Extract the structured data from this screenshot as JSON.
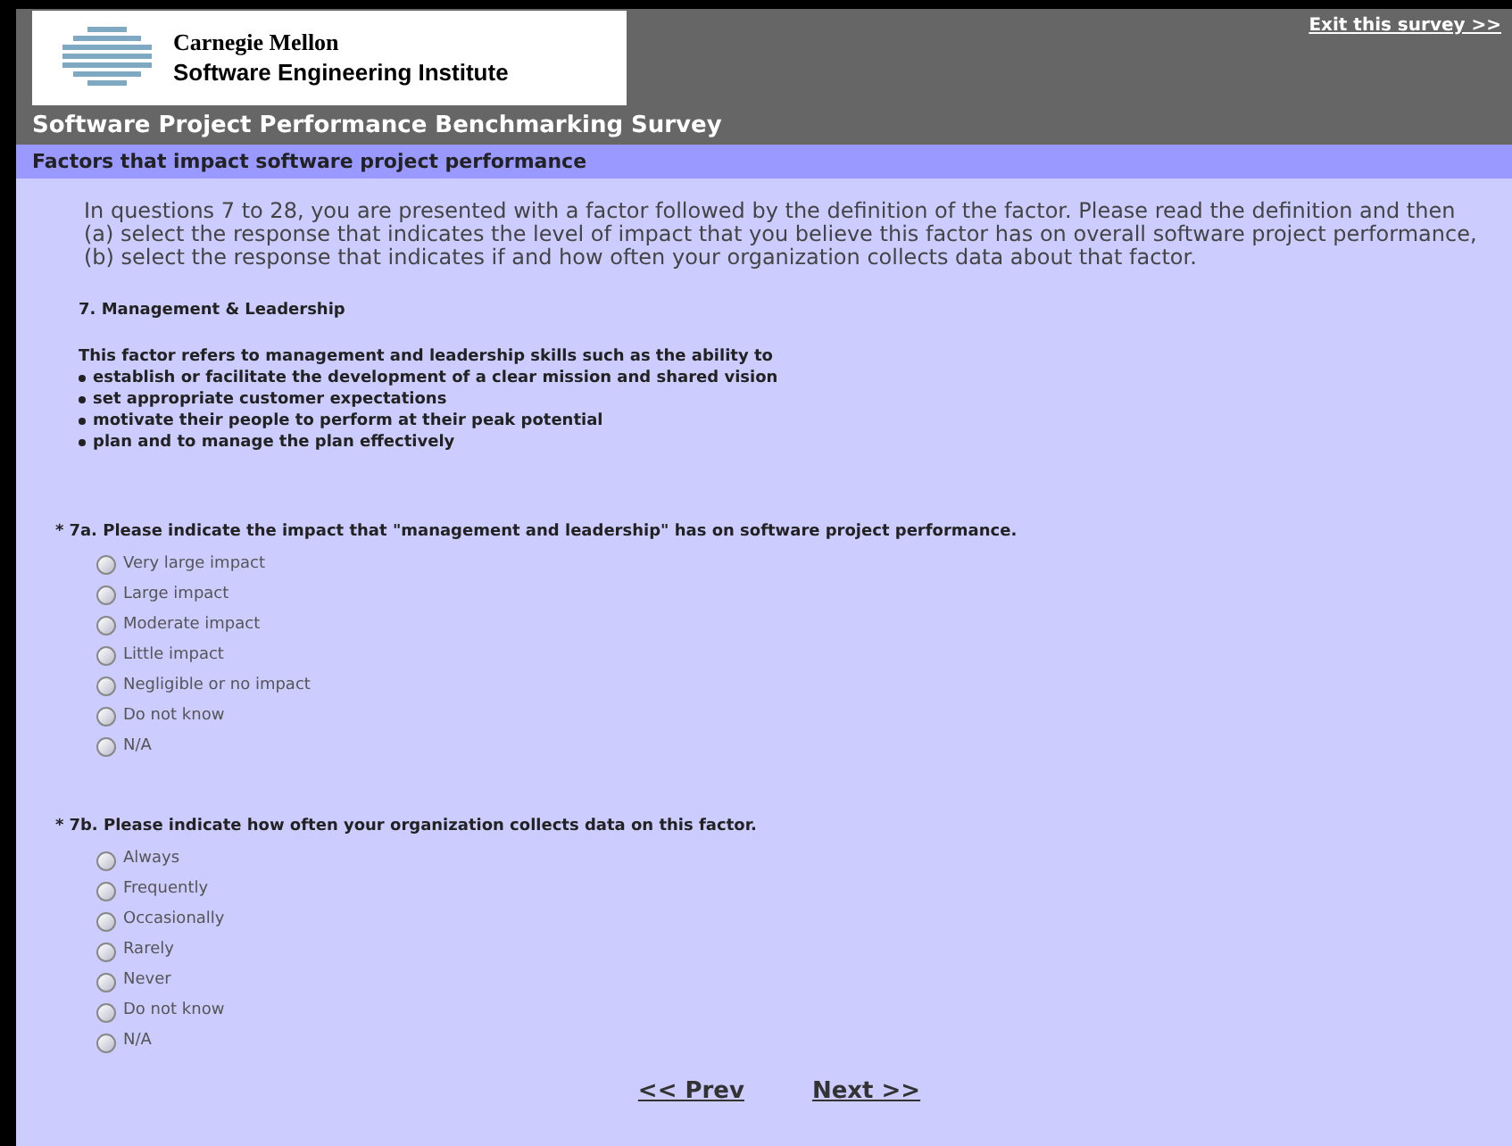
{
  "header": {
    "logo": {
      "line1": "Carnegie Mellon",
      "line2": "Software Engineering Institute"
    },
    "exit_link": "Exit this survey >>"
  },
  "survey_title": "Software Project Performance Benchmarking Survey",
  "page_title": "Factors that impact software project performance",
  "intro": "In questions 7 to 28, you are presented with a factor followed by the definition of the factor. Please read the definition and then (a) select the response that indicates the level of impact that you believe this factor has on overall software project performance, (b) select the response that indicates if and how often your organization collects data about that factor.",
  "factor": {
    "heading": "7. Management & Leadership",
    "lead": "This factor refers to management and leadership skills such as the ability to",
    "bullets": [
      "establish or facilitate the development of a clear mission and shared vision",
      "set appropriate customer expectations",
      "motivate their people to perform at their peak potential",
      "plan and to manage the plan effectively"
    ]
  },
  "questions": [
    {
      "required_mark": "*",
      "text": "7a. Please indicate the impact that \"management and leadership\" has on software project performance.",
      "options": [
        {
          "label": "Very large impact",
          "selected": false
        },
        {
          "label": "Large impact",
          "selected": false
        },
        {
          "label": "Moderate impact",
          "selected": false
        },
        {
          "label": "Little impact",
          "selected": false
        },
        {
          "label": "Negligible or no impact",
          "selected": false
        },
        {
          "label": "Do not know",
          "selected": false
        },
        {
          "label": "N/A",
          "selected": false
        }
      ]
    },
    {
      "required_mark": "*",
      "text": "7b. Please indicate how often your organization collects data on this factor.",
      "options": [
        {
          "label": "Always",
          "selected": false
        },
        {
          "label": "Frequently",
          "selected": false
        },
        {
          "label": "Occasionally",
          "selected": false
        },
        {
          "label": "Rarely",
          "selected": false
        },
        {
          "label": "Never",
          "selected": false
        },
        {
          "label": "Do not know",
          "selected": false
        },
        {
          "label": "N/A",
          "selected": false
        }
      ]
    }
  ],
  "nav": {
    "prev": "<< Prev",
    "next": "Next >>"
  }
}
